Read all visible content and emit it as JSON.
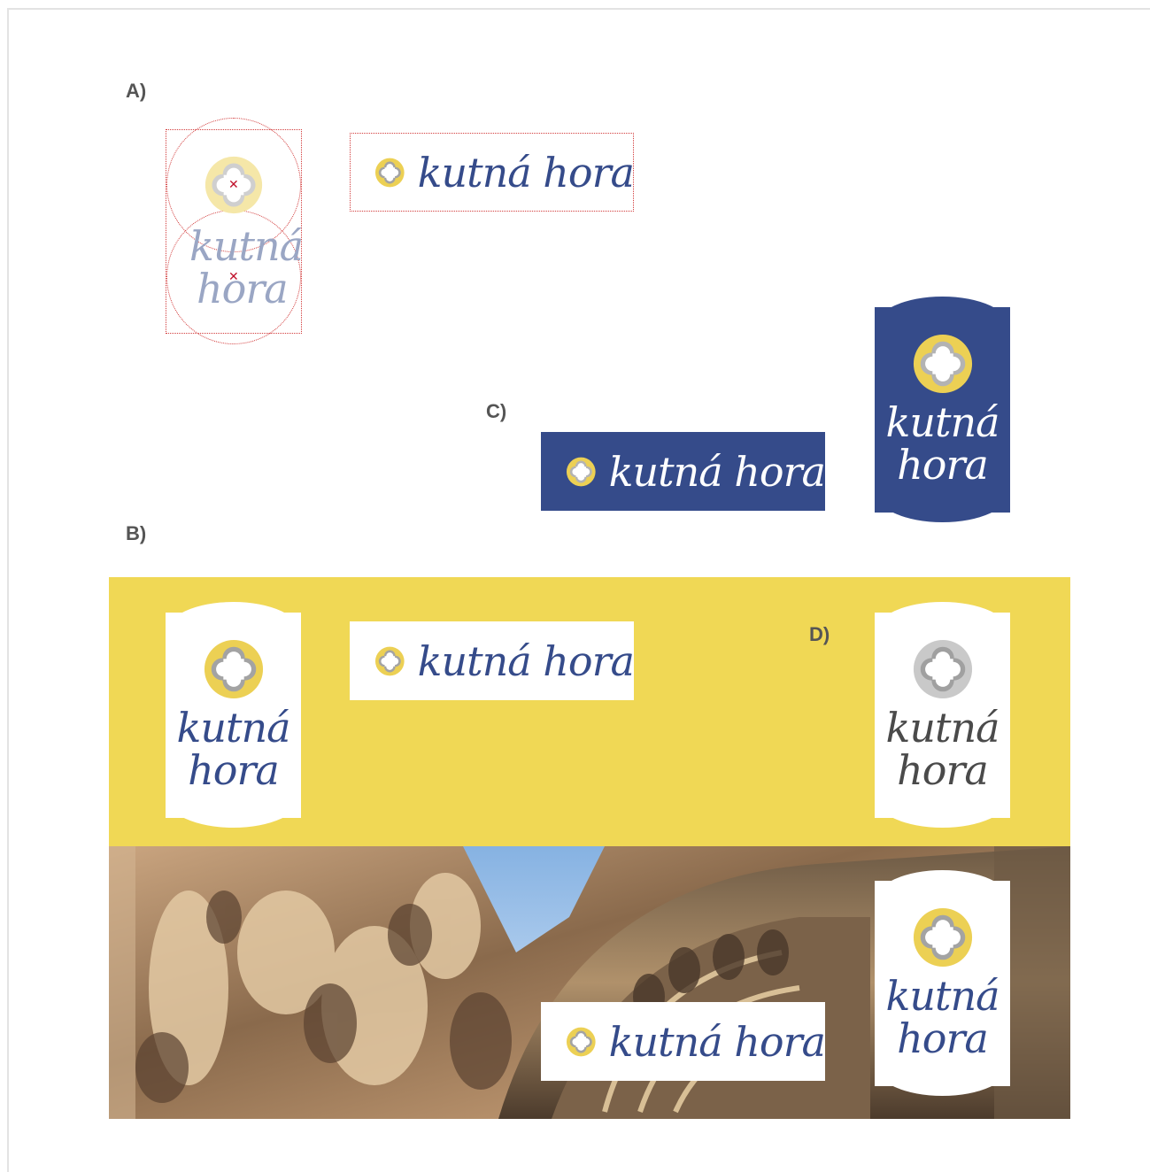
{
  "labels": {
    "a": "A)",
    "b": "B)",
    "c": "C)",
    "d": "D)"
  },
  "brand": {
    "line1": "kutná",
    "line2": "hora",
    "full": "kutná hora"
  },
  "colors": {
    "navy": "#354b8a",
    "yellow": "#f0d855",
    "ring_yellow": "#ecd054",
    "quatrefoil_grey": "#9e9e9e",
    "guide_red": "#d23b3b",
    "mono_text": "#4a4a4a",
    "white": "#ffffff"
  },
  "icons": [
    "quatrefoil-logo-icon",
    "center-cross-icon"
  ]
}
